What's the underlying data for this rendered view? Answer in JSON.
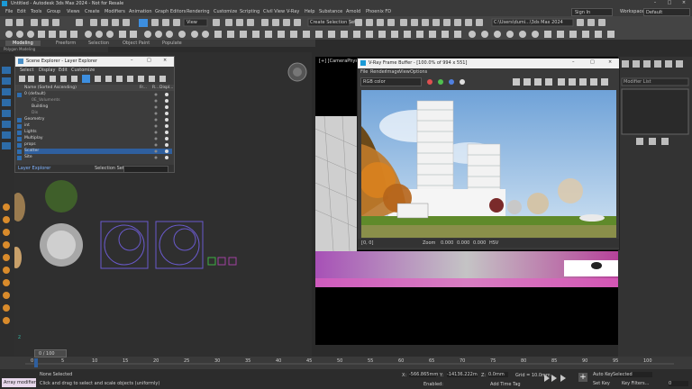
{
  "title": "Untitled - Autodesk 3ds Max 2024 - Not for Resale",
  "sign_in": "Sign In",
  "workspaces_label": "Workspaces:",
  "workspaces_value": "Default",
  "menus": [
    "File",
    "Edit",
    "Tools",
    "Group",
    "Views",
    "Create",
    "Modifiers",
    "Animation",
    "Graph Editors",
    "Rendering",
    "Customize",
    "Scripting",
    "Civil View",
    "V-Ray",
    "Help",
    "Substance",
    "Arnold",
    "Phoenix FD"
  ],
  "toolbar": {
    "view_dropdown": "View",
    "selection_set": "Create Selection Set",
    "path": "C:\\Users\\dumi...\\3ds Max 2024"
  },
  "ribbon_tabs": [
    "Modeling",
    "Freeform",
    "Selection",
    "Object Paint",
    "Populate"
  ],
  "ribbon_sub": "Polygon Modeling",
  "viewport_label": "[+] [CameraPhysical001] [...]",
  "scene_explorer": {
    "title": "Scene Explorer - Layer Explorer",
    "menu": [
      "Select",
      "Display",
      "Edit",
      "Customize"
    ],
    "col_name": "Name (Sorted Ascending)",
    "cols": [
      "Fr...",
      "R...",
      "Displ..."
    ],
    "rows": [
      "0 (default)",
      "0E_Voluments",
      "Building",
      "Dis",
      "Geometry",
      "int",
      "Lights",
      "Multiplay",
      "props",
      "Scatter",
      "Site"
    ],
    "footer_left": "Layer Explorer",
    "footer_right": "Selection Set:"
  },
  "vfb": {
    "title": "V-Ray Frame Buffer - [100.0% of 994 x 551]",
    "menu": [
      "File",
      "Render",
      "Image",
      "View",
      "Options"
    ],
    "color_space": "RGB color",
    "status_left": "[0, 0]",
    "status_mid": "Zoom",
    "status_vals": [
      "0.000",
      "0.000",
      "0.000"
    ],
    "status_hsv": "HSV"
  },
  "time_slider": "0 / 100",
  "timeline_ticks": [
    "0",
    "5",
    "10",
    "15",
    "20",
    "25",
    "30",
    "35",
    "40",
    "45",
    "50",
    "55",
    "60",
    "65",
    "70",
    "75",
    "80",
    "85",
    "90",
    "95",
    "100"
  ],
  "status": {
    "maxscript": "Array modifier",
    "selected": "None Selected",
    "prompt": "Click and drag to select and scale objects (uniformly)",
    "x_label": "X:",
    "x_val": "-566.865mm",
    "y_label": "Y:",
    "y_val": "-14136.222m",
    "z_label": "Z:",
    "z_val": "0.0mm",
    "grid": "Grid = 10.0mm",
    "enabled": "Enabled:",
    "add_time_tag": "Add Time Tag",
    "auto_key": "Auto Key",
    "set_key": "Set Key",
    "selected_dd": "Selected",
    "key_filters": "Key Filters..."
  },
  "modifier_list": "Modifier List",
  "frame_field": "0"
}
